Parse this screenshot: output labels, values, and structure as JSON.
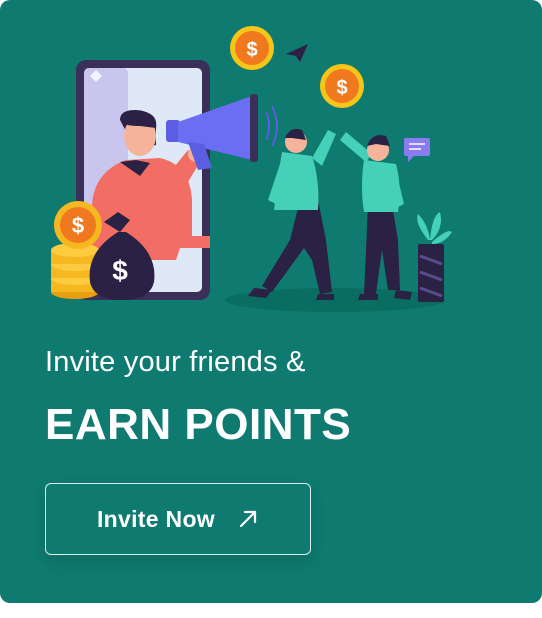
{
  "card": {
    "subtitle": "Invite your friends &",
    "title": "EARN POINTS",
    "button_label": "Invite Now",
    "button_icon": "arrow-up-right-icon",
    "coin_symbol": "$",
    "colors": {
      "background": "#0e7a70",
      "coin": "#f0a81c",
      "accent_teal": "#44d1b8",
      "text": "#ffffff"
    }
  }
}
